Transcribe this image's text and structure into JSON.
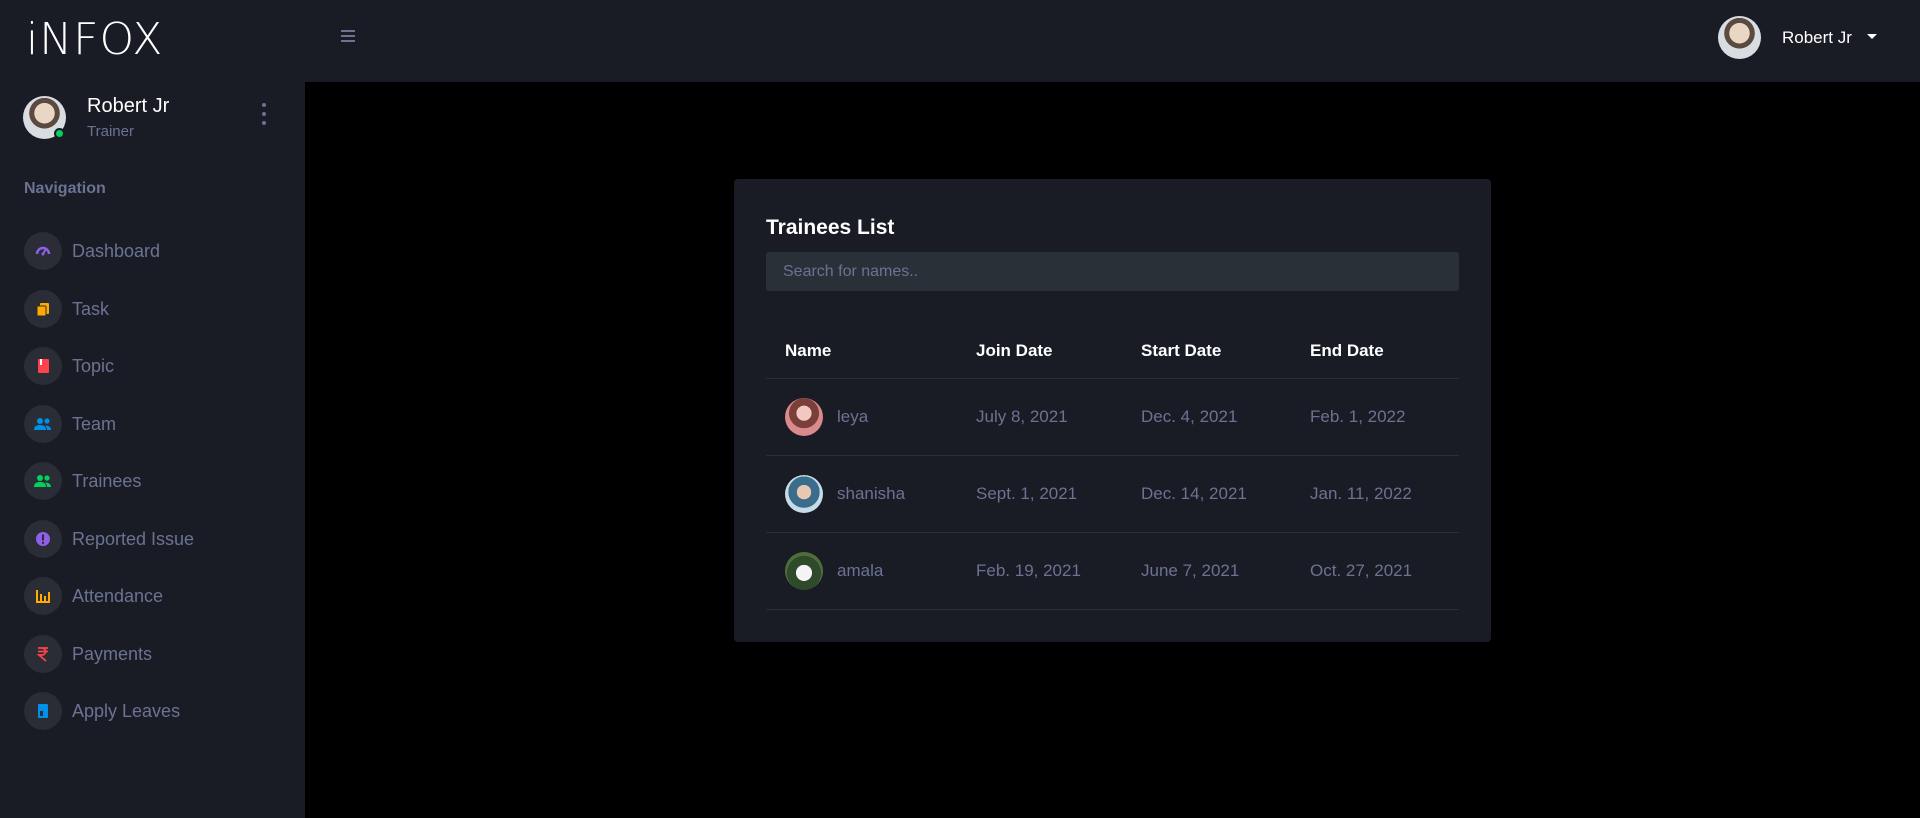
{
  "brand": "iNFOX",
  "sidebar": {
    "profile": {
      "name": "Robert Jr",
      "role": "Trainer"
    },
    "nav_heading": "Navigation",
    "items": [
      {
        "label": "Dashboard",
        "icon": "speedometer-icon",
        "color": "#8f5fe8"
      },
      {
        "label": "Task",
        "icon": "copy-icon",
        "color": "#ffab00"
      },
      {
        "label": "Topic",
        "icon": "book-icon",
        "color": "#fc424a"
      },
      {
        "label": "Team",
        "icon": "group-icon",
        "color": "#0090e7"
      },
      {
        "label": "Trainees",
        "icon": "group-icon",
        "color": "#00d25b"
      },
      {
        "label": "Reported Issue",
        "icon": "alert-circle-icon",
        "color": "#8f5fe8"
      },
      {
        "label": "Attendance",
        "icon": "bar-chart-icon",
        "color": "#ffab00"
      },
      {
        "label": "Payments",
        "icon": "rupee-icon",
        "color": "#fc424a"
      },
      {
        "label": "Apply Leaves",
        "icon": "notebook-icon",
        "color": "#0090e7"
      }
    ]
  },
  "topbar": {
    "user_name": "Robert Jr"
  },
  "card": {
    "title": "Trainees List",
    "search_placeholder": "Search for names..",
    "columns": [
      "Name",
      "Join Date",
      "Start Date",
      "End Date"
    ],
    "rows": [
      {
        "name": "leya",
        "join": "July 8, 2021",
        "start": "Dec. 4, 2021",
        "end": "Feb. 1, 2022"
      },
      {
        "name": "shanisha",
        "join": "Sept. 1, 2021",
        "start": "Dec. 14, 2021",
        "end": "Jan. 11, 2022"
      },
      {
        "name": "amala",
        "join": "Feb. 19, 2021",
        "start": "June 7, 2021",
        "end": "Oct. 27, 2021"
      }
    ]
  }
}
